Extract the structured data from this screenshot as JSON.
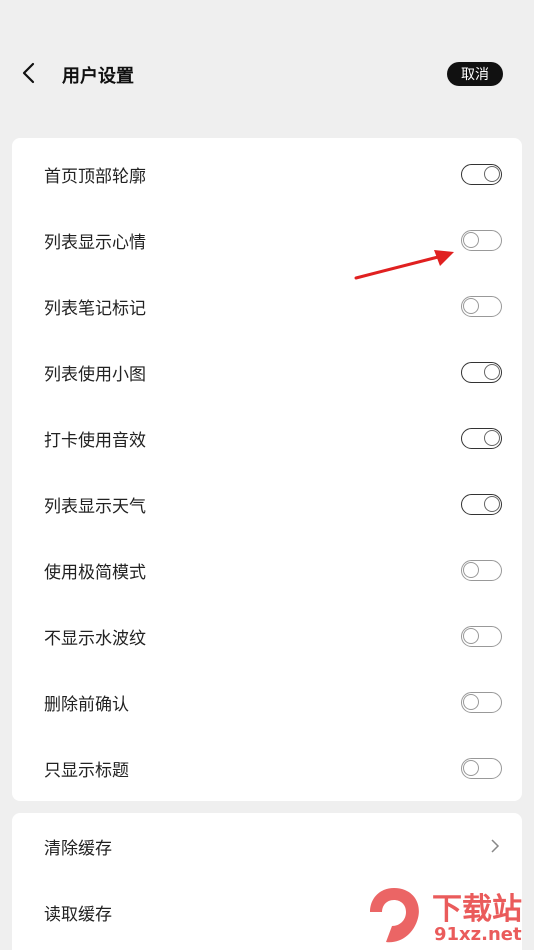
{
  "header": {
    "title": "用户设置",
    "cancel_label": "取消"
  },
  "settings": [
    {
      "label": "首页顶部轮廓",
      "on": true
    },
    {
      "label": "列表显示心情",
      "on": false
    },
    {
      "label": "列表笔记标记",
      "on": false
    },
    {
      "label": "列表使用小图",
      "on": true
    },
    {
      "label": "打卡使用音效",
      "on": true
    },
    {
      "label": "列表显示天气",
      "on": true
    },
    {
      "label": "使用极简模式",
      "on": false
    },
    {
      "label": "不显示水波纹",
      "on": false
    },
    {
      "label": "删除前确认",
      "on": false
    },
    {
      "label": "只显示标题",
      "on": false
    }
  ],
  "cache": [
    {
      "label": "清除缓存"
    },
    {
      "label": "读取缓存"
    }
  ],
  "watermark": {
    "text1": "下载站",
    "text2": "91xz.net"
  },
  "colors": {
    "accent_arrow": "#e02020",
    "toggle_on": "#333333",
    "toggle_off": "#999999"
  }
}
